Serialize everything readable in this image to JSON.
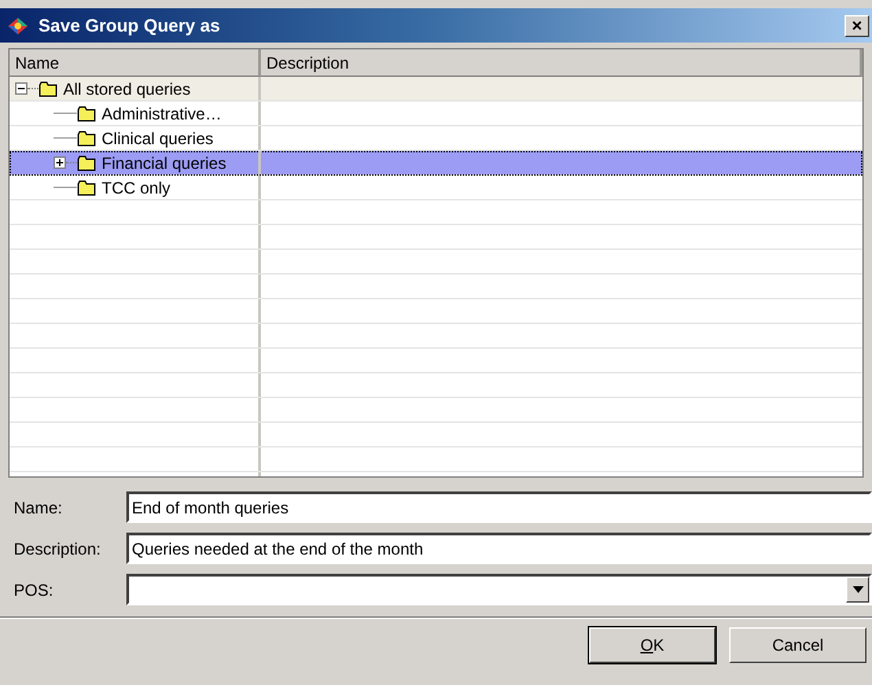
{
  "window": {
    "title": "Save Group Query as",
    "close": "×"
  },
  "table": {
    "columns": [
      "Name",
      "Description"
    ],
    "tree": [
      {
        "label": "All stored queries",
        "expanded": true,
        "selected": false,
        "children": [
          {
            "label": "Administrative…",
            "selected": false
          },
          {
            "label": "Clinical queries",
            "selected": false
          },
          {
            "label": "Financial queries",
            "expanded": false,
            "selected": true
          },
          {
            "label": "TCC only",
            "selected": false
          }
        ]
      }
    ]
  },
  "form": [
    {
      "kind": "text",
      "label": "Name:",
      "value": "End of month queries"
    },
    {
      "kind": "text",
      "label": "Description:",
      "value": "Queries needed at the end of the month"
    },
    {
      "kind": "dropdown",
      "label": "POS:"
    }
  ],
  "buttons": [
    "OK",
    "Cancel"
  ]
}
